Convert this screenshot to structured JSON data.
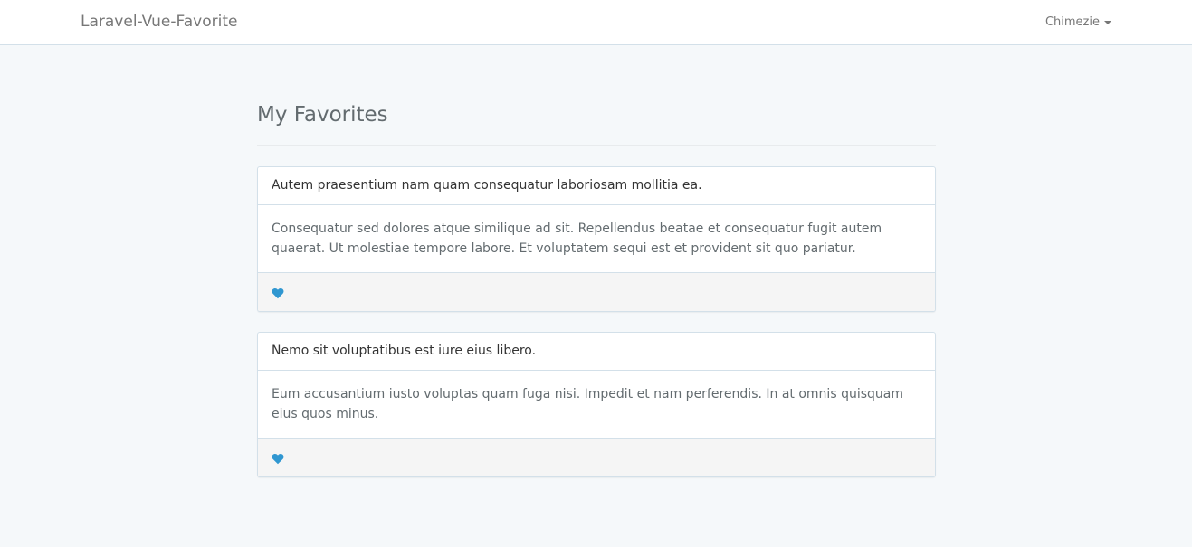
{
  "navbar": {
    "brand": "Laravel-Vue-Favorite",
    "user_name": "Chimezie"
  },
  "page": {
    "title": "My Favorites"
  },
  "favorites": [
    {
      "title": "Autem praesentium nam quam consequatur laboriosam mollitia ea.",
      "body": "Consequatur sed dolores atque similique ad sit. Repellendus beatae et consequatur fugit autem quaerat. Ut molestiae tempore labore. Et voluptatem sequi est et provident sit quo pariatur.",
      "icon": "heart-icon"
    },
    {
      "title": "Nemo sit voluptatibus est iure eius libero.",
      "body": "Eum accusantium iusto voluptas quam fuga nisi. Impedit et nam perferendis. In at omnis quisquam eius quos minus.",
      "icon": "heart-icon"
    }
  ],
  "colors": {
    "background": "#f5f8fa",
    "heart": "#3097d1",
    "panel_border": "#d3e0e9"
  }
}
